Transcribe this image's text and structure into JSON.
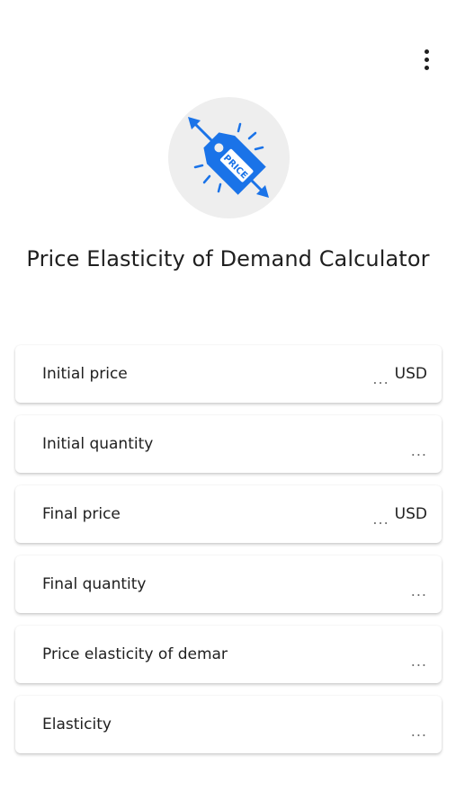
{
  "app": {
    "title": "Price Elasticity of Demand Calculator",
    "logo_icon": "price-tag-icon",
    "logo_tag_text": "PRICE",
    "accent_color": "#1a73e8"
  },
  "toolbar": {
    "menu_icon": "more-vert-icon"
  },
  "fields": [
    {
      "label": "Initial price",
      "placeholder": "...",
      "unit": "USD"
    },
    {
      "label": "Initial quantity",
      "placeholder": "...",
      "unit": ""
    },
    {
      "label": "Final price",
      "placeholder": "...",
      "unit": "USD"
    },
    {
      "label": "Final quantity",
      "placeholder": "...",
      "unit": ""
    },
    {
      "label": "Price elasticity of demand",
      "placeholder": "...",
      "unit": ""
    },
    {
      "label": "Elasticity",
      "placeholder": "...",
      "unit": ""
    }
  ]
}
